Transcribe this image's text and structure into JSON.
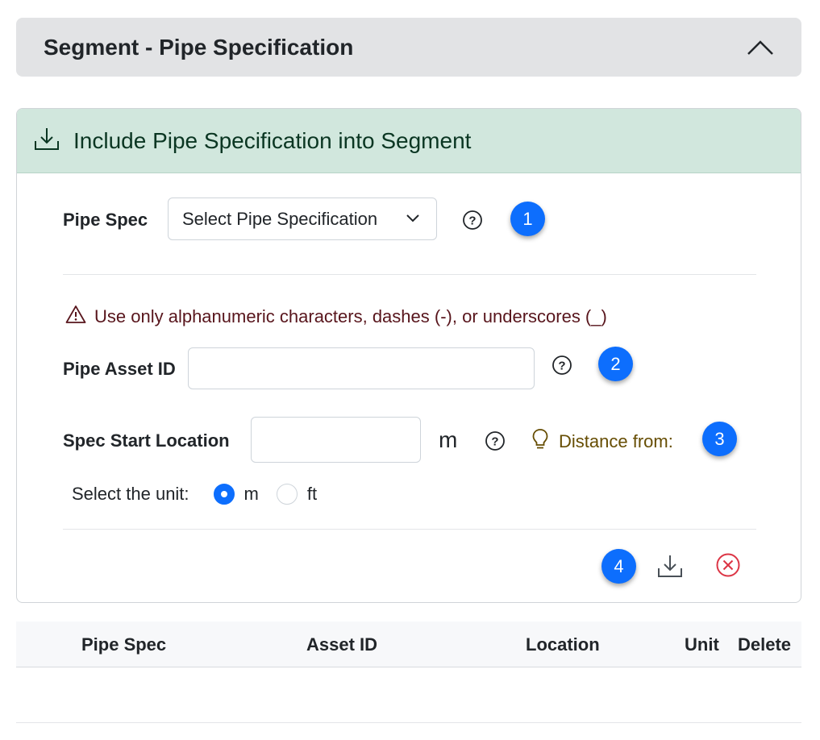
{
  "accordion": {
    "title": "Segment - Pipe Specification"
  },
  "card": {
    "header_title": "Include Pipe Specification into Segment"
  },
  "pipe_spec": {
    "label": "Pipe Spec",
    "select_value": "Select Pipe Specification",
    "badge": "1"
  },
  "warning": {
    "text": "Use only alphanumeric characters, dashes (-), or underscores (_)"
  },
  "asset_id": {
    "label": "Pipe Asset ID",
    "value": "",
    "badge": "2"
  },
  "start_location": {
    "label": "Spec Start Location",
    "value": "",
    "unit": "m",
    "hint": "Distance from:",
    "badge": "3"
  },
  "unit_select": {
    "label": "Select the unit:",
    "options": [
      {
        "label": "m",
        "selected": true
      },
      {
        "label": "ft",
        "selected": false
      }
    ]
  },
  "actions": {
    "badge": "4"
  },
  "table": {
    "columns": [
      "Pipe Spec",
      "Asset ID",
      "Location",
      "Unit",
      "Delete"
    ],
    "rows": []
  },
  "colors": {
    "primary": "#0d6efd",
    "success_bg": "#d1e7dd",
    "danger": "#dc3545",
    "warning_text": "#58151c",
    "hint_text": "#664d03"
  },
  "icons": [
    "chevron-up-icon",
    "download-icon",
    "chevron-down-icon",
    "question-circle-icon",
    "warning-triangle-icon",
    "lightbulb-icon",
    "close-circle-icon"
  ]
}
